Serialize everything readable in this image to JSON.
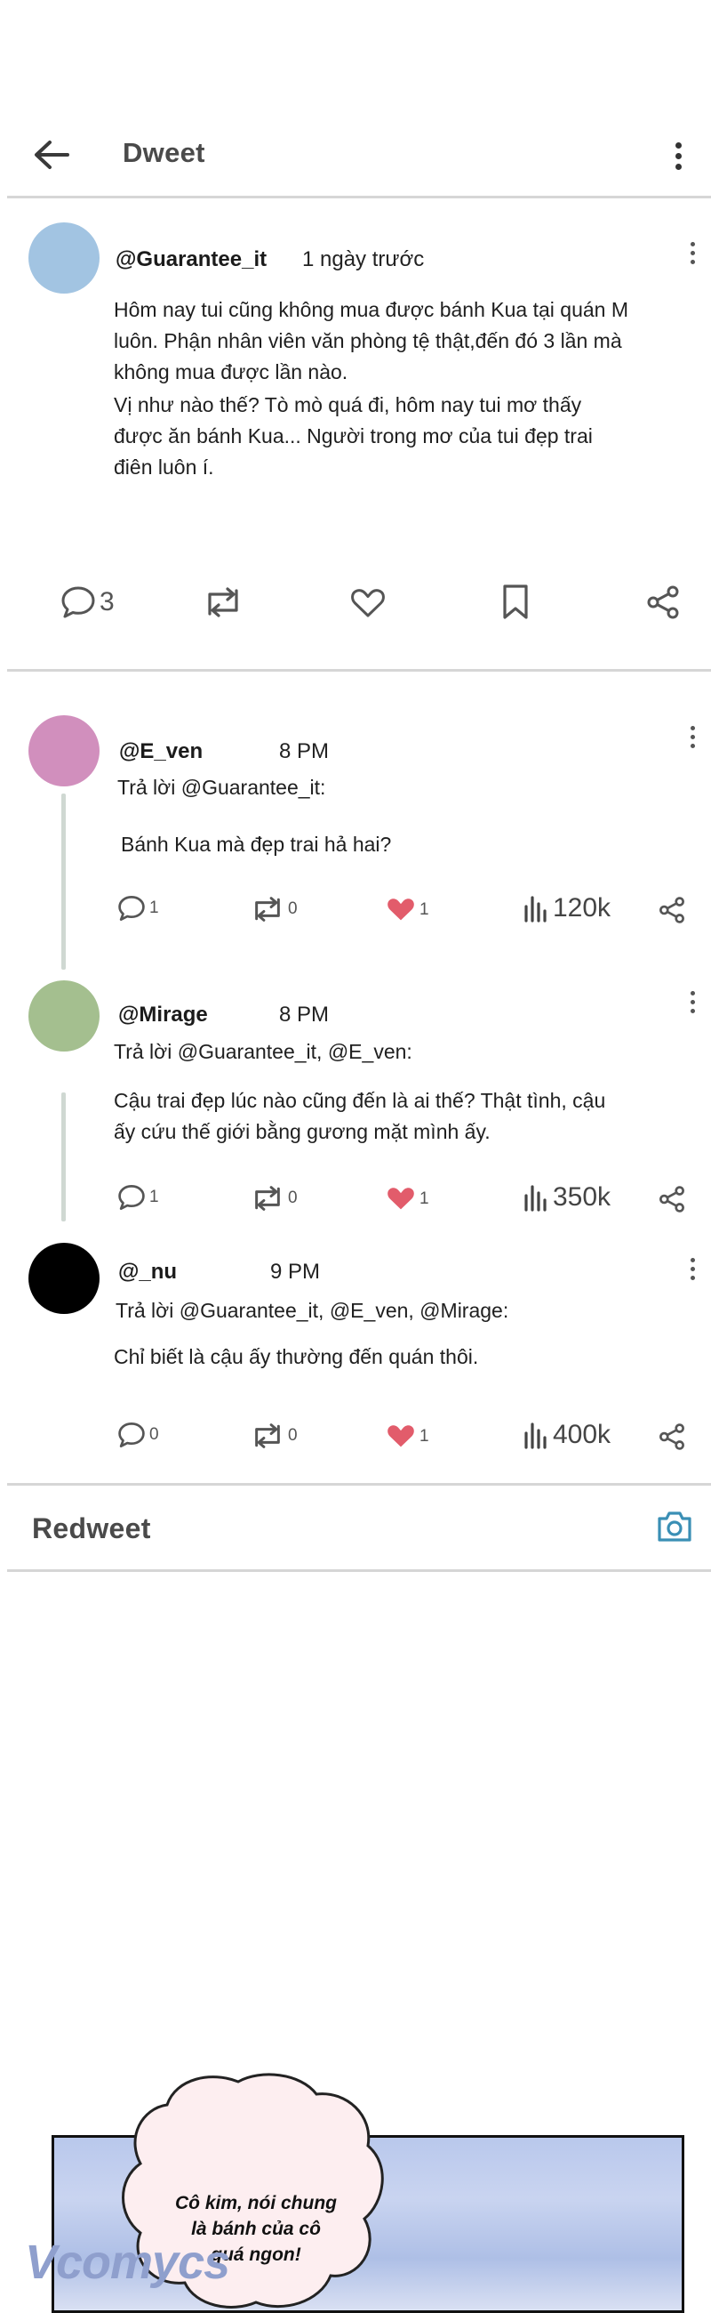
{
  "header": {
    "title": "Dweet",
    "back_icon": "arrow-left-icon",
    "menu_icon": "more-vertical-icon"
  },
  "post": {
    "handle": "@Guarantee_it",
    "time": "1 ngày trước",
    "body_1": "Hôm nay tui cũng không mua được bánh Kua tại quán M luôn. Phận nhân viên văn phòng tệ thật,đến đó 3 lần mà không mua được lần nào.",
    "body_2": "Vị như nào thế? Tò mò quá đi, hôm nay tui mơ thấy được ăn bánh Kua... Người trong mơ của tui đẹp trai điên luôn í.",
    "reply_count": "3",
    "avatar_color": "#a2c4e2"
  },
  "replies": [
    {
      "handle": "@E_ven",
      "time": "8 PM",
      "reply_to": "Trả lời @Guarantee_it:",
      "text": "Bánh Kua mà đẹp trai hả hai?",
      "comments": "1",
      "redweets": "0",
      "likes": "1",
      "views": "120k",
      "avatar_color": "#d18fbd"
    },
    {
      "handle": "@Mirage",
      "time": "8 PM",
      "reply_to": "Trả lời @Guarantee_it, @E_ven:",
      "text": "Cậu trai đẹp lúc nào cũng đến là ai thế? Thật tình, cậu ấy cứu thế giới bằng gương mặt mình ấy.",
      "comments": "1",
      "redweets": "0",
      "likes": "1",
      "views": "350k",
      "avatar_color": "#a4bf8f"
    },
    {
      "handle": "@_nu",
      "time": "9 PM",
      "reply_to": "Trả lời @Guarantee_it, @E_ven, @Mirage:",
      "text": "Chỉ biết là cậu ấy thường đến quán thôi.",
      "comments": "0",
      "redweets": "0",
      "likes": "1",
      "views": "400k",
      "avatar_color": "#000000"
    }
  ],
  "footer": {
    "title": "Redweet",
    "camera_icon": "camera-icon"
  },
  "comic": {
    "bubble_line_1": "Cô kim, nói chung",
    "bubble_line_2": "là bánh của cô",
    "bubble_line_3": "quá ngon!",
    "watermark": "Vcomycs"
  },
  "colors": {
    "like": "#e25c6b",
    "camera": "#3a8fb5",
    "divider": "#d6d6d6"
  }
}
